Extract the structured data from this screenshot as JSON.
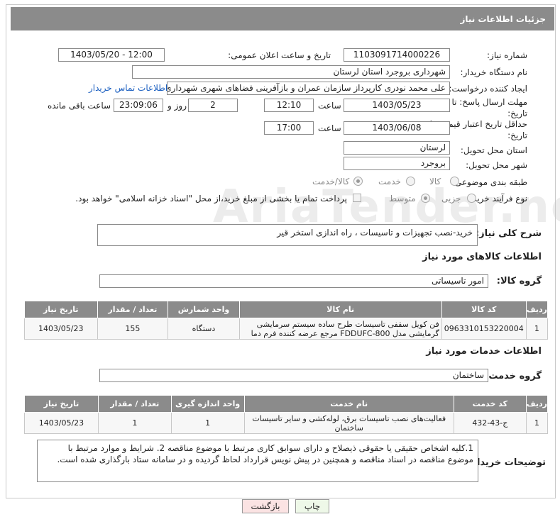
{
  "header": {
    "title": "جزئیات اطلاعات نیاز"
  },
  "form": {
    "need_number_label": "شماره نیاز:",
    "need_number": "1103091714000226",
    "announce_label": "تاریخ و ساعت اعلان عمومی:",
    "announce_value": "1403/05/20 - 12:00",
    "buyer_org_label": "نام دستگاه خریدار:",
    "buyer_org": "شهرداری بروجرد استان لرستان",
    "creator_label": "ایجاد کننده درخواست:",
    "creator": "علی محمد نودری کارپرداز سازمان عمران و بازآفرینی فضاهای شهری شهرداری بر",
    "contact_link": "اطلاعات تماس خریدار",
    "deadline_label_1": "مهلت ارسال پاسخ: تا",
    "deadline_label_2": "تاریخ:",
    "deadline_date": "1403/05/23",
    "time_label": "ساعت",
    "deadline_time": "12:10",
    "days_value": "2",
    "days_label": "روز و",
    "remaining_time": "23:09:06",
    "remaining_label": "ساعت باقی مانده",
    "validity_label_1": "حداقل تاریخ اعتبار قیمت: تا",
    "validity_label_2": "تاریخ:",
    "validity_date": "1403/06/08",
    "validity_time": "17:00",
    "province_label": "استان محل تحویل:",
    "province": "لرستان",
    "city_label": "شهر محل تحویل:",
    "city": "بروجرد",
    "category_label": "طبقه بندی موضوعی:",
    "category_options": [
      "کالا",
      "خدمت",
      "کالا/خدمت"
    ],
    "process_label": "نوع فرآیند خرید :",
    "process_options": [
      "جزیی",
      "متوسط"
    ],
    "payment_note": "پرداخت تمام یا بخشی از مبلغ خرید،از محل \"اسناد خزانه اسلامی\" خواهد بود.",
    "summary_label": "شرح کلی نیاز:",
    "summary": "خرید-نصب تجهیزات و تاسیسات ، راه اندازی استخر قیر"
  },
  "goods": {
    "section_title": "اطلاعات کالاهای مورد نیاز",
    "group_label": "گروه کالا:",
    "group": "امور تاسیساتی",
    "columns": [
      "ردیف",
      "کد کالا",
      "نام کالا",
      "واحد شمارش",
      "تعداد / مقدار",
      "تاریخ نیاز"
    ],
    "rows": [
      {
        "row": "1",
        "code": "0963310153220004",
        "name": "فن کویل سقفی تاسیسات طرح ساده سیستم سرمایشی گرمایشی مدل FDDUFC-800 مرجع عرضه کننده فرم دما",
        "unit": "دستگاه",
        "qty": "155",
        "date": "1403/05/23"
      }
    ]
  },
  "services": {
    "section_title": "اطلاعات خدمات مورد نیاز",
    "group_label": "گروه خدمت:",
    "group": "ساختمان",
    "columns": [
      "ردیف",
      "کد خدمت",
      "نام خدمت",
      "واحد اندازه گیری",
      "تعداد / مقدار",
      "تاریخ نیاز"
    ],
    "rows": [
      {
        "row": "1",
        "code": "ج-43-432",
        "name": "فعالیت‌های نصب تاسیسات برق، لوله‌کشی و سایر تاسیسات ساختمان",
        "unit": "1",
        "qty": "1",
        "date": "1403/05/23"
      }
    ]
  },
  "notes": {
    "label": "توضیحات خریدار:",
    "text": "1.کلیه اشخاص حقیقی یا حقوقی ذیصلاح و دارای سوابق کاری مرتبط با موضوع مناقصه 2. شرایط و موارد مرتبط با موضوع مناقصه در اسناد مناقصه  و همچنین در پیش نویس قرارداد لحاظ گردیده و در سامانه ستاد بارگذاری شده است."
  },
  "buttons": {
    "print": "چاپ",
    "back": "بازگشت"
  },
  "watermark": "AriaTender.neT"
}
